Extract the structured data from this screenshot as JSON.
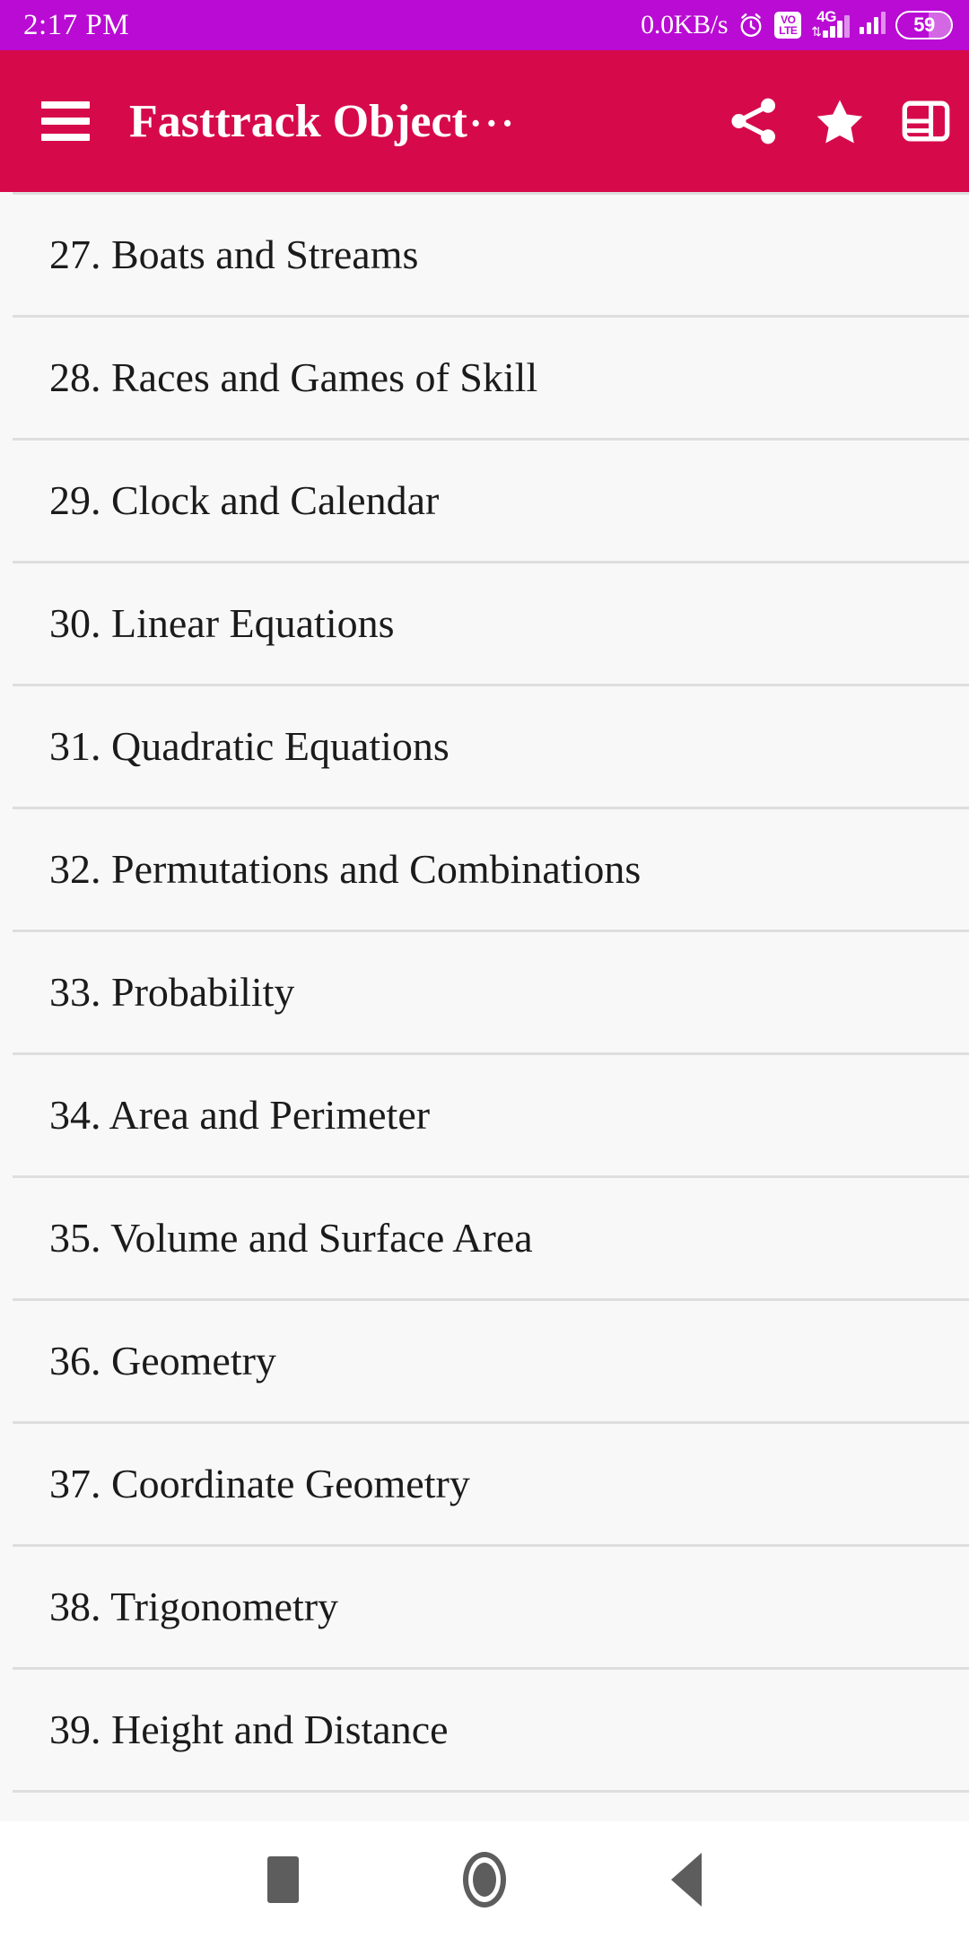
{
  "status_bar": {
    "background_color": "#b90bd4",
    "clock": "2:17 PM",
    "network_speed": "0.0KB/s",
    "alarm_icon": "alarm-clock-icon",
    "volte_line1": "VO",
    "volte_line2": "LTE",
    "network_type": "4G",
    "data_arrows": "⇅",
    "battery_level": "59"
  },
  "app_bar": {
    "background_color": "#d60a4b",
    "menu_icon": "hamburger-menu-icon",
    "title": "Fasttrack Object",
    "title_truncation": "···",
    "share_icon": "share-icon",
    "favorite_icon": "star-icon",
    "view_mode_icon": "layout-view-icon"
  },
  "content": {
    "background_color": "#f8f8f8",
    "text_color": "#1b1b1b",
    "divider_color": "#dedede",
    "items": [
      {
        "number": "27.",
        "title": "Boats and Streams",
        "label": "27. Boats and Streams"
      },
      {
        "number": "28.",
        "title": "Races and Games of Skill",
        "label": "28. Races and Games of Skill"
      },
      {
        "number": "29.",
        "title": "Clock and Calendar",
        "label": "29. Clock and Calendar"
      },
      {
        "number": "30.",
        "title": "Linear Equations",
        "label": "30. Linear Equations"
      },
      {
        "number": "31.",
        "title": "Quadratic Equations",
        "label": "31. Quadratic Equations"
      },
      {
        "number": "32.",
        "title": "Permutations and Combinations",
        "label": "32. Permutations and Combinations"
      },
      {
        "number": "33.",
        "title": "Probability",
        "label": "33. Probability"
      },
      {
        "number": "34.",
        "title": "Area and Perimeter",
        "label": "34. Area and Perimeter"
      },
      {
        "number": "35.",
        "title": "Volume and Surface Area",
        "label": "35. Volume and Surface Area"
      },
      {
        "number": "36.",
        "title": "Geometry",
        "label": "36. Geometry"
      },
      {
        "number": "37.",
        "title": "Coordinate Geometry",
        "label": "37. Coordinate Geometry"
      },
      {
        "number": "38.",
        "title": "Trigonometry",
        "label": "38. Trigonometry"
      },
      {
        "number": "39.",
        "title": "Height and Distance",
        "label": "39. Height and Distance"
      }
    ]
  },
  "nav_bar": {
    "background_color": "#ffffff",
    "icon_color": "#5d5d5d",
    "recents_icon": "square-recents-icon",
    "home_icon": "circle-home-icon",
    "back_icon": "triangle-back-icon"
  }
}
